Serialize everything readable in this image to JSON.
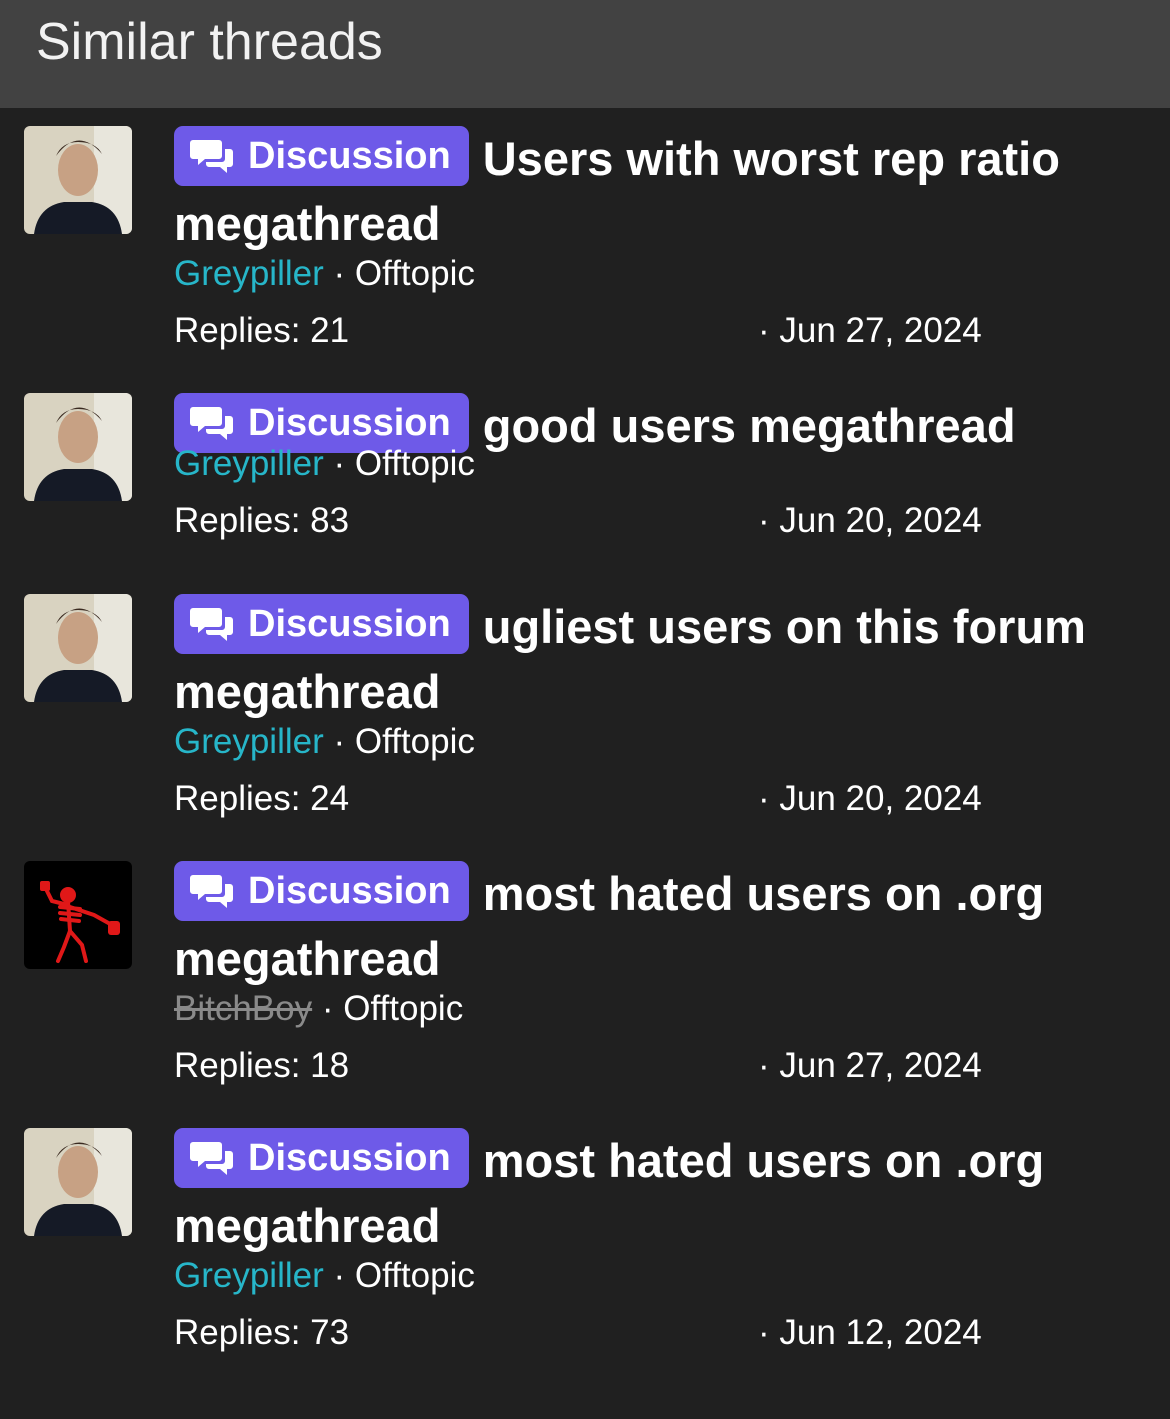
{
  "header": {
    "title": "Similar threads"
  },
  "badge_label": "Discussion",
  "threads": [
    {
      "title": "Users with worst rep ratio megathread",
      "author": "Greypiller",
      "forum": "Offtopic",
      "replies_label": "Replies: 21",
      "date": "· Jun 27, 2024",
      "avatar": "person-photo"
    },
    {
      "title": "good users megathread",
      "author": "Greypiller",
      "forum": "Offtopic",
      "replies_label": "Replies: 83",
      "date": "· Jun 20, 2024",
      "avatar": "person-photo"
    },
    {
      "title": "ugliest users on this forum megathread",
      "author": "Greypiller",
      "forum": "Offtopic",
      "replies_label": "Replies: 24",
      "date": "· Jun 20, 2024",
      "avatar": "person-photo"
    },
    {
      "title": "most hated users on .org megathread",
      "author": "BitchBoy",
      "forum": "Offtopic",
      "replies_label": "Replies: 18",
      "date": "· Jun 27, 2024",
      "avatar": "red-skeleton"
    },
    {
      "title": "most hated users on .org megathread",
      "author": "Greypiller",
      "forum": "Offtopic",
      "replies_label": "Replies: 73",
      "date": "· Jun 12, 2024",
      "avatar": "person-photo"
    }
  ],
  "meta_separator": " · ",
  "colors": {
    "background": "#202020",
    "header": "#424242",
    "badge": "#6e5ae8",
    "author_link": "#27b6c9",
    "banned_author": "#8a8a8a"
  }
}
